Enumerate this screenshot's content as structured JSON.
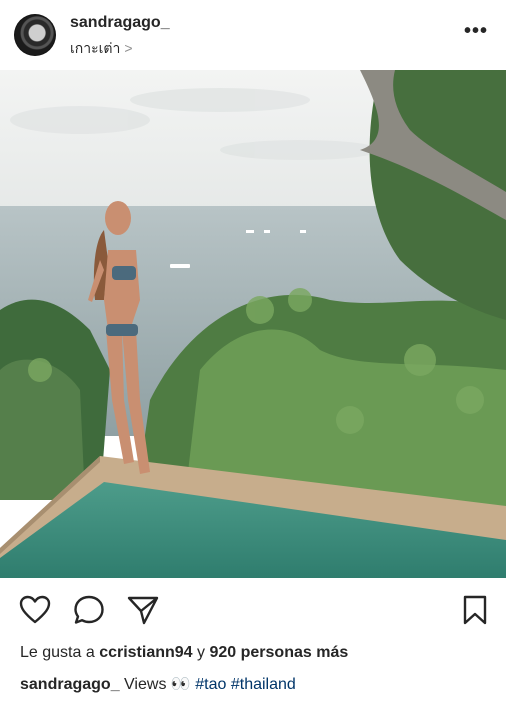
{
  "post": {
    "username": "sandragago_",
    "location": "เกาะเต่า",
    "location_chevron": ">",
    "more_label": "•••"
  },
  "photo": {
    "description_icon": "photo"
  },
  "actions": {
    "icons": [
      "heart-icon",
      "comment-icon",
      "share-icon",
      "bookmark-icon"
    ]
  },
  "likes": {
    "prefix": "Le gusta a",
    "user": "ccristiann94",
    "connector": "y",
    "others": "920 personas más"
  },
  "caption": {
    "username": "sandragago_",
    "text": "Views 👀",
    "tags": [
      "#tao",
      "#thailand"
    ]
  },
  "colors": {
    "text": "#262626",
    "hashtag": "#003569",
    "secondary": "#8e8e8e"
  }
}
